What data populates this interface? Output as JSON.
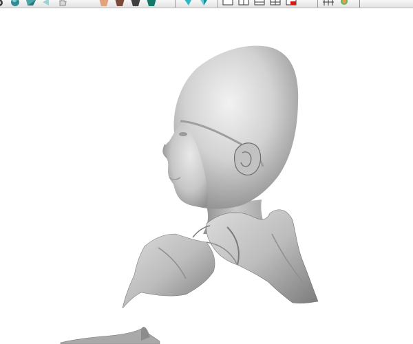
{
  "window": {
    "title": ""
  },
  "toolbar": {
    "groups": [
      {
        "name": "view-group",
        "icons": [
          "rotate-icon",
          "sphere-icon",
          "cube-view-icon",
          "arrow-left-icon",
          "hand-icon"
        ]
      },
      {
        "name": "material-group",
        "icons": [
          "skin-shade-icon",
          "brown-shade-icon",
          "dark-shade-icon",
          "teal-shade-icon"
        ]
      },
      {
        "name": "camera-group",
        "icons": [
          "cyan-front-icon",
          "cyan-side-icon"
        ]
      },
      {
        "name": "layout-group",
        "icons": [
          "layout-single-icon",
          "layout-split-icon",
          "layout-grid-icon",
          "layout-quad-icon",
          "close-red-icon"
        ]
      },
      {
        "name": "tools-group",
        "icons": [
          "measure-icon",
          "reset-green-icon"
        ]
      }
    ]
  },
  "viewport": {
    "background": "#ffffff",
    "model": {
      "description_label": "",
      "shade_color": "#cfcfcf"
    }
  },
  "colors": {
    "toolbar_bg": "#ececec",
    "separator": "#9a9a9a",
    "surface_light": "#e8e8e8",
    "surface_mid": "#bdbdbd",
    "surface_dark": "#6e6e6e"
  }
}
